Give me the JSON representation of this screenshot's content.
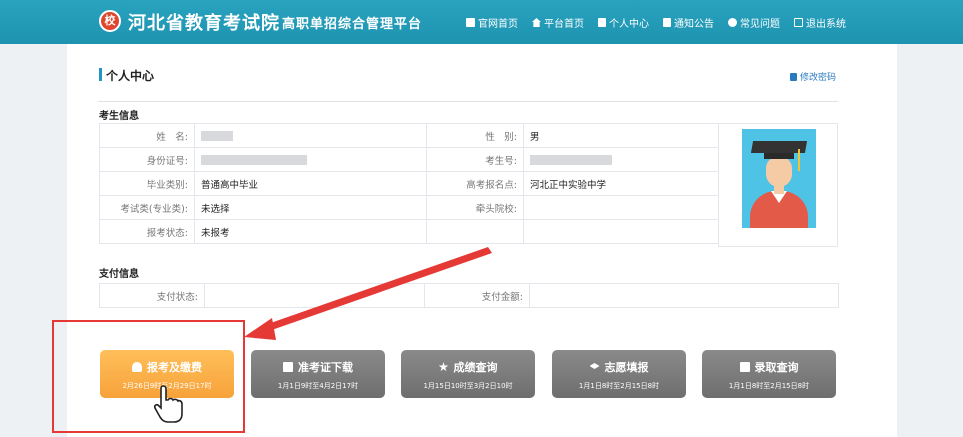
{
  "header": {
    "logo_text": "校",
    "site_name": "河北省教育考试院",
    "platform_name": "高职单招综合管理平台",
    "nav": [
      {
        "label": "官网首页",
        "icon": "flag-icon"
      },
      {
        "label": "平台首页",
        "icon": "home-icon"
      },
      {
        "label": "个人中心",
        "icon": "person-icon"
      },
      {
        "label": "通知公告",
        "icon": "notice-icon"
      },
      {
        "label": "常见问题",
        "icon": "chat-icon"
      },
      {
        "label": "退出系统",
        "icon": "logout-icon"
      }
    ]
  },
  "page": {
    "title": "个人中心",
    "change_password": "修改密码"
  },
  "student_info": {
    "title": "考生信息",
    "rows": [
      {
        "l1": "姓　名:",
        "v1": "",
        "l2": "性　别:",
        "v2": "男"
      },
      {
        "l1": "身份证号:",
        "v1": "",
        "l2": "考生号:",
        "v2": ""
      },
      {
        "l1": "毕业类别:",
        "v1": "普通高中毕业",
        "l2": "高考报名点:",
        "v2": "河北正中实验中学"
      },
      {
        "l1": "考试类(专业类):",
        "v1": "未选择",
        "l2": "牵头院校:",
        "v2": ""
      },
      {
        "l1": "报考状态:",
        "v1": "未报考",
        "l2": "",
        "v2": ""
      }
    ]
  },
  "payment_info": {
    "title": "支付信息",
    "status_label": "支付状态:",
    "status_value": "",
    "amount_label": "支付金额:",
    "amount_value": ""
  },
  "actions": [
    {
      "title": "报考及缴费",
      "date": "2月26日9时至2月29日17时",
      "active": true
    },
    {
      "title": "准考证下载",
      "date": "1月1日9时至4月2日17时",
      "active": false
    },
    {
      "title": "成绩查询",
      "date": "1月15日10时至3月2日10时",
      "active": false
    },
    {
      "title": "志愿填报",
      "date": "1月1日8时至2月15日8时",
      "active": false
    },
    {
      "title": "录取查询",
      "date": "1月1日8时至2月15日8时",
      "active": false
    }
  ],
  "colors": {
    "header": "#1d93b0",
    "active_button": "#f7a23a",
    "inactive_button": "#7a7a7a",
    "highlight": "#e53935"
  }
}
